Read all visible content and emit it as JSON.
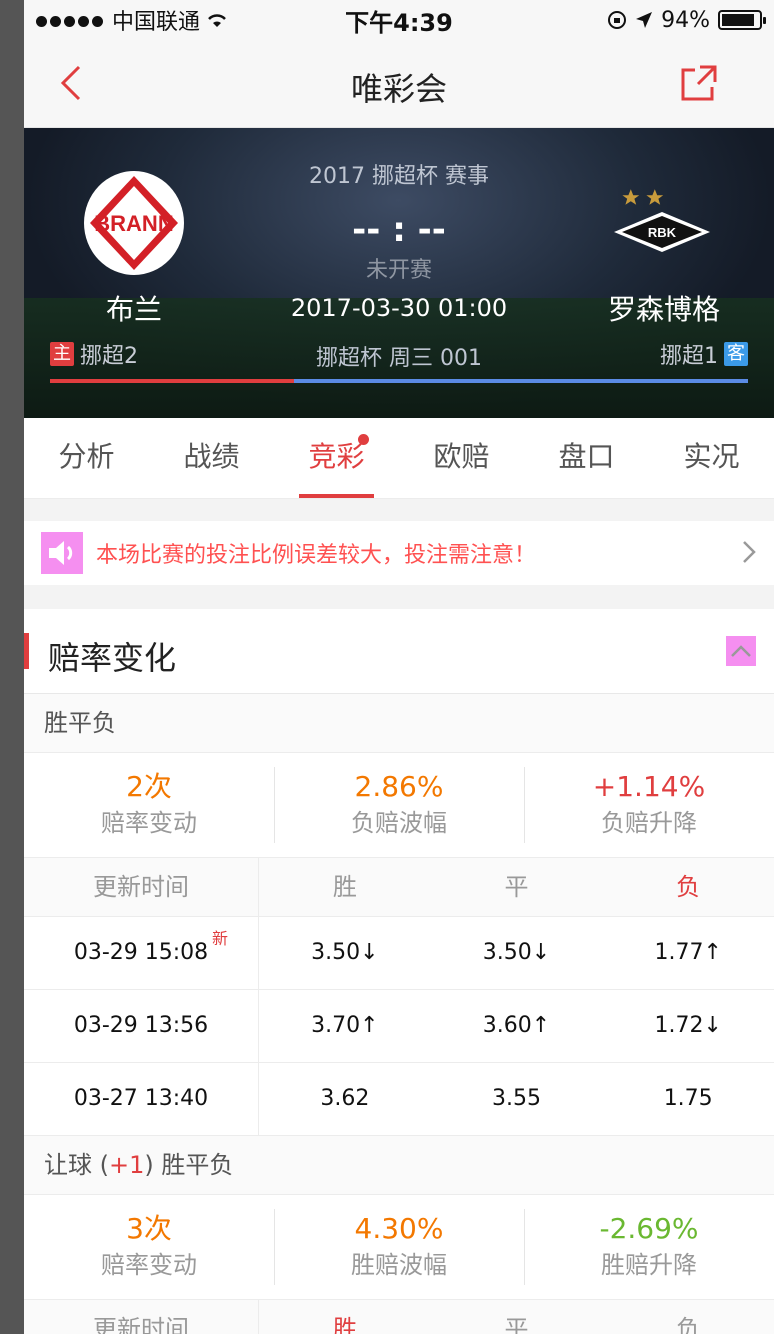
{
  "status_bar": {
    "carrier": "中国联通",
    "time": "下午4:39",
    "battery": "94%"
  },
  "nav": {
    "title": "唯彩会"
  },
  "match": {
    "competition": "2017 挪超杯 赛事",
    "score": "-- : --",
    "status": "未开赛",
    "datetime": "2017-03-30 01:00",
    "round": "挪超杯 周三 001",
    "home": {
      "logo_text": "BRANN",
      "name": "布兰",
      "tag": "主",
      "rank": "挪超2"
    },
    "away": {
      "logo_text": "RBK",
      "name": "罗森博格",
      "tag": "客",
      "rank": "挪超1"
    },
    "colors": {
      "home": "#e03e3f",
      "away": "#5b8be5"
    }
  },
  "tabs": [
    "分析",
    "战绩",
    "竞彩",
    "欧赔",
    "盘口",
    "实况"
  ],
  "notice": {
    "text": "本场比赛的投注比例误差较大，投注需注意！"
  },
  "odds_section": {
    "title": "赔率变化",
    "group1": {
      "label": "胜平负",
      "stats": [
        {
          "value": "2次",
          "label": "赔率变动"
        },
        {
          "value": "2.86%",
          "label": "负赔波幅"
        },
        {
          "value": "+1.14%",
          "label": "负赔升降"
        }
      ],
      "headers": [
        "更新时间",
        "胜",
        "平",
        "负"
      ],
      "rows": [
        {
          "time": "03-29 15:08",
          "new": "新",
          "win": "3.50↓",
          "draw": "3.50↓",
          "lose": "1.77↑"
        },
        {
          "time": "03-29 13:56",
          "win": "3.70↑",
          "draw": "3.60↑",
          "lose": "1.72↓"
        },
        {
          "time": "03-27 13:40",
          "win": "3.62",
          "draw": "3.55",
          "lose": "1.75"
        }
      ]
    },
    "group2": {
      "label_pre": "让球 (",
      "label_handicap": "+1",
      "label_post": ") 胜平负",
      "stats": [
        {
          "value": "3次",
          "label": "赔率变动"
        },
        {
          "value": "4.30%",
          "label": "胜赔波幅"
        },
        {
          "value": "-2.69%",
          "label": "胜赔升降"
        }
      ],
      "headers": [
        "更新时间",
        "胜",
        "平",
        "负"
      ]
    }
  }
}
